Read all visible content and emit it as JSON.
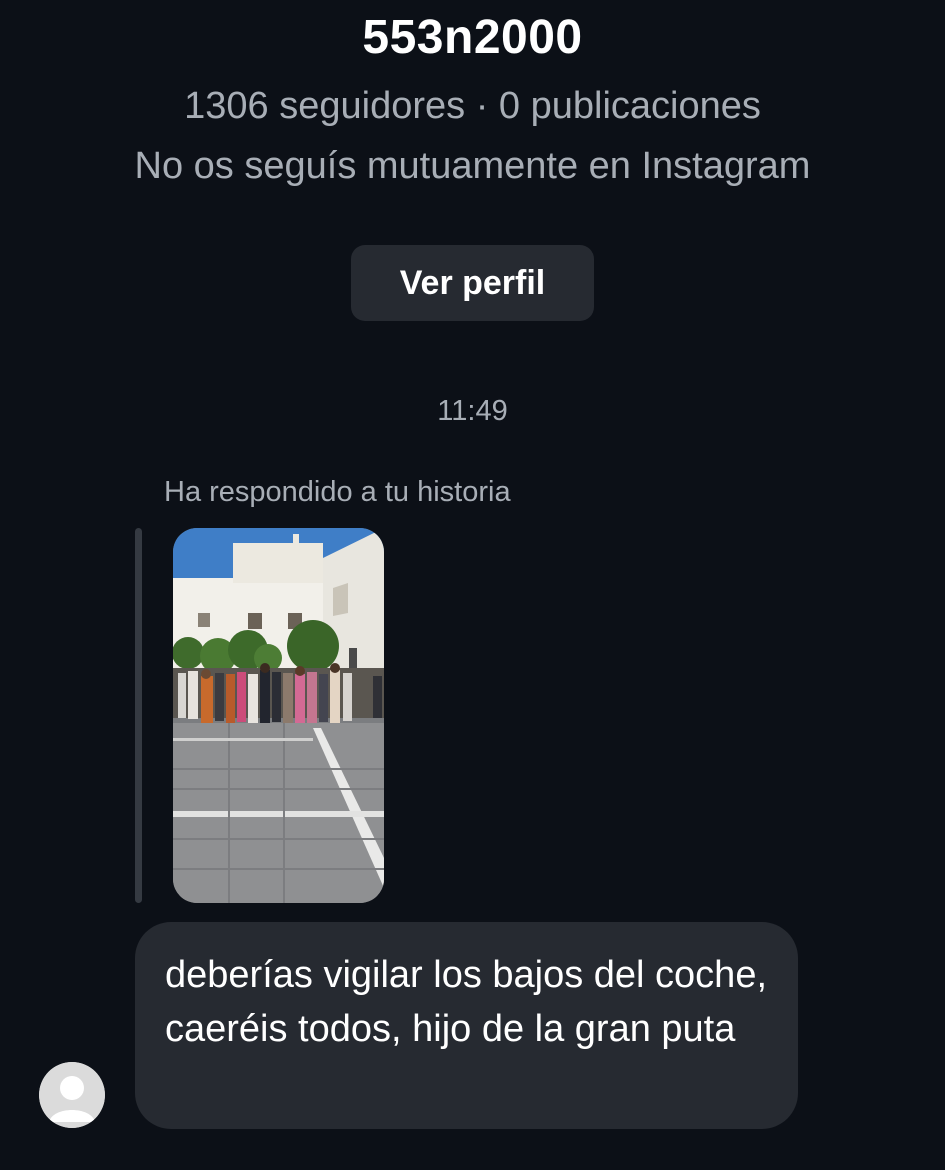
{
  "profile": {
    "username": "553n2000",
    "stats": "1306 seguidores · 0 publicaciones",
    "mutual_status": "No os seguís mutuamente en Instagram",
    "view_profile_label": "Ver perfil"
  },
  "thread": {
    "timestamp": "11:49",
    "reply_label": "Ha respondido a tu historia",
    "story_preview": "story-photo-thumbnail",
    "message_text": "deberías vigilar los bajos del coche, caeréis todos, hijo de la gran puta",
    "sender_avatar": "default-avatar-icon"
  },
  "colors": {
    "background": "#0c1017",
    "bubble": "#262a31",
    "secondary_text": "#a8aeb6",
    "primary_text": "#ffffff"
  }
}
